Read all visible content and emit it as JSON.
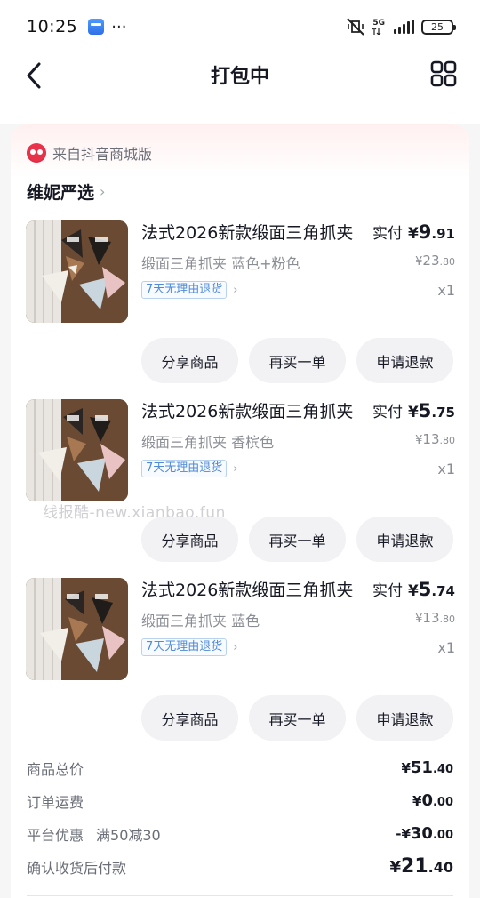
{
  "status_bar": {
    "time": "10:25",
    "more": "···",
    "network": "5G",
    "battery": "25"
  },
  "nav": {
    "title": "打包中"
  },
  "source": "来自抖音商城版",
  "shop": {
    "name": "维妮严选"
  },
  "products": [
    {
      "title": "法式2026新款缎面三角抓夹",
      "paid_label": "实付",
      "paid_currency": "¥",
      "paid_int": "9",
      "paid_dec": ".91",
      "spec": "缎面三角抓夹 蓝色+粉色",
      "orig_currency": "¥",
      "orig_int": "23",
      "orig_dec": ".80",
      "tag": "7天无理由退货",
      "qty": "x1",
      "buttons": [
        "分享商品",
        "再买一单",
        "申请退款"
      ]
    },
    {
      "title": "法式2026新款缎面三角抓夹",
      "paid_label": "实付",
      "paid_currency": "¥",
      "paid_int": "5",
      "paid_dec": ".75",
      "spec": "缎面三角抓夹 香槟色",
      "orig_currency": "¥",
      "orig_int": "13",
      "orig_dec": ".80",
      "tag": "7天无理由退货",
      "qty": "x1",
      "buttons": [
        "分享商品",
        "再买一单",
        "申请退款"
      ]
    },
    {
      "title": "法式2026新款缎面三角抓夹",
      "paid_label": "实付",
      "paid_currency": "¥",
      "paid_int": "5",
      "paid_dec": ".74",
      "spec": "缎面三角抓夹 蓝色",
      "orig_currency": "¥",
      "orig_int": "13",
      "orig_dec": ".80",
      "tag": "7天无理由退货",
      "qty": "x1",
      "buttons": [
        "分享商品",
        "再买一单",
        "申请退款"
      ]
    }
  ],
  "watermark": "线报酷-new.xianbao.fun",
  "summary": {
    "total_label": "商品总价",
    "total_currency": "¥",
    "total_int": "51",
    "total_dec": ".40",
    "shipping_label": "订单运费",
    "shipping_currency": "¥",
    "shipping_int": "0",
    "shipping_dec": ".00",
    "discount_label": "平台优惠",
    "discount_sub": "满50减30",
    "discount_currency": "-¥",
    "discount_int": "30",
    "discount_dec": ".00",
    "final_label": "确认收货后付款",
    "final_currency": "¥",
    "final_int": "21",
    "final_dec": ".40"
  },
  "colors": {
    "accent_text": "#161823",
    "muted_text": "#8a8d94",
    "tag_blue": "#4f8ad6",
    "card_tint": "#fff0f0",
    "logo_red": "#e8324a"
  }
}
